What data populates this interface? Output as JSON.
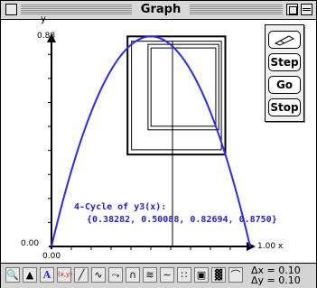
{
  "window": {
    "title": "Graph"
  },
  "axes": {
    "y_label": "y",
    "y_max": "0.88",
    "y_min": "0.00",
    "x_min": "0.00",
    "x_max": "1.00 x"
  },
  "annotation": {
    "line1": "4-Cycle of y3(x):",
    "line2": "{0.38282, 0.50088, 0.82694, 0.8750}"
  },
  "palette": {
    "step": "Step",
    "go": "Go",
    "stop": "Stop",
    "tool_icon": "pencil-eraser-icon"
  },
  "toolbar": {
    "tools": [
      "zoom-icon",
      "arrow-icon",
      "text-A-icon",
      "xy-icon",
      "line-icon",
      "curve-icon",
      "derivative-icon",
      "iterate-icon",
      "wave-icon",
      "dots-icon",
      "cobweb-icon",
      "grid-icon",
      "curve-small-icon"
    ],
    "dx": "Δx = 0.10",
    "dy": "Δy = 0.10"
  },
  "colors": {
    "curve": "#2a2aff",
    "annotation": "#1f1fcf",
    "cobweb": "#000000"
  },
  "chart_data": {
    "type": "line",
    "function": "logistic map y = r x (1 - x), r = 3.5",
    "xlim": [
      0,
      1
    ],
    "ylim": [
      0,
      0.88
    ],
    "x": [
      0,
      0.1,
      0.2,
      0.3,
      0.4,
      0.5,
      0.6,
      0.7,
      0.8,
      0.9,
      1.0
    ],
    "y": [
      0,
      0.315,
      0.56,
      0.735,
      0.84,
      0.875,
      0.84,
      0.735,
      0.56,
      0.315,
      0
    ],
    "cycle": [
      0.38282,
      0.50088,
      0.82694,
      0.875
    ],
    "tick_step": 0.1
  }
}
